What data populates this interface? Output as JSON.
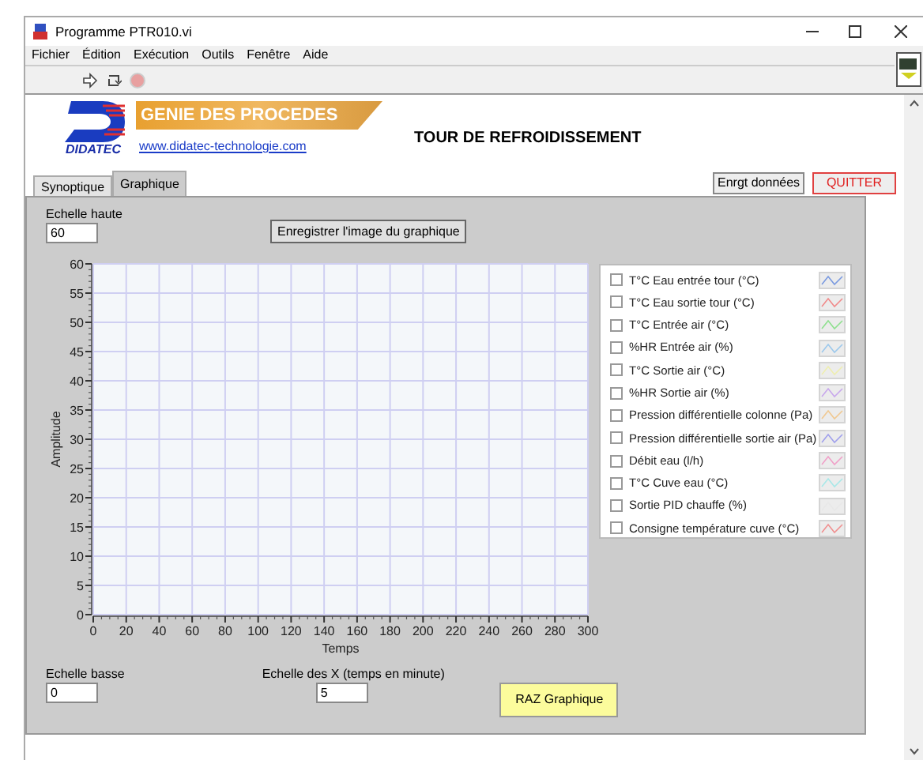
{
  "window": {
    "title": "Programme PTR010.vi"
  },
  "menu": [
    "Fichier",
    "Édition",
    "Exécution",
    "Outils",
    "Fenêtre",
    "Aide"
  ],
  "header": {
    "logo_text": "DIDATEC",
    "banner": "GENIE DES PROCEDES",
    "link": "www.didatec-technologie.com",
    "title": "TOUR DE REFROIDISSEMENT"
  },
  "buttons": [
    {
      "label": "Enrgt données",
      "kind": "normal"
    },
    {
      "label": "QUITTER",
      "kind": "danger"
    }
  ],
  "tabs": [
    {
      "label": "Synoptique",
      "selected": false
    },
    {
      "label": "Graphique",
      "selected": true
    }
  ],
  "graph_panel": {
    "top_scale": {
      "label": "Echelle haute",
      "value": "60"
    },
    "save_button": "Enregistrer l'image du graphique",
    "chart_data": {
      "type": "line",
      "grid": true,
      "xlabel": "Temps",
      "ylabel": "Amplitude",
      "xlim": [
        0,
        300
      ],
      "ylim": [
        0,
        60
      ],
      "xticks": [
        0,
        20,
        40,
        60,
        80,
        100,
        120,
        140,
        160,
        180,
        200,
        220,
        240,
        260,
        280,
        300
      ],
      "yticks": [
        0,
        5,
        10,
        15,
        20,
        25,
        30,
        35,
        40,
        45,
        50,
        55,
        60
      ]
    },
    "legend": [
      {
        "label": "T°C Eau entrée tour (°C)",
        "checked": false,
        "color": "#7a9ae0"
      },
      {
        "label": "T°C Eau sortie tour (°C)",
        "checked": false,
        "color": "#f08a8a"
      },
      {
        "label": "T°C Entrée air (°C)",
        "checked": false,
        "color": "#8ee08e"
      },
      {
        "label": "%HR Entrée air (%)",
        "checked": false,
        "color": "#9cc8ec"
      },
      {
        "label": "T°C Sortie air (°C)",
        "checked": false,
        "color": "#eeeeb0"
      },
      {
        "label": "%HR Sortie air (%)",
        "checked": false,
        "color": "#c8a8ec"
      },
      {
        "label": "Pression différentielle colonne (Pa)",
        "checked": false,
        "color": "#f0c890"
      },
      {
        "label": "Pression différentielle sortie air (Pa)",
        "checked": false,
        "color": "#a0a0ec"
      },
      {
        "label": "Débit eau (l/h)",
        "checked": false,
        "color": "#f0a0c8"
      },
      {
        "label": "T°C Cuve eau (°C)",
        "checked": false,
        "color": "#a8e8e8"
      },
      {
        "label": "Sortie PID chauffe (%)",
        "checked": false,
        "color": "#e8e8e8"
      },
      {
        "label": "Consigne température cuve (°C)",
        "checked": false,
        "color": "#f09090"
      }
    ],
    "bottom_scale": {
      "label": "Echelle basse",
      "value": "0"
    },
    "x_scale": {
      "label": "Echelle des X (temps en minute)",
      "value": "5"
    },
    "reset_button": "RAZ Graphique"
  }
}
